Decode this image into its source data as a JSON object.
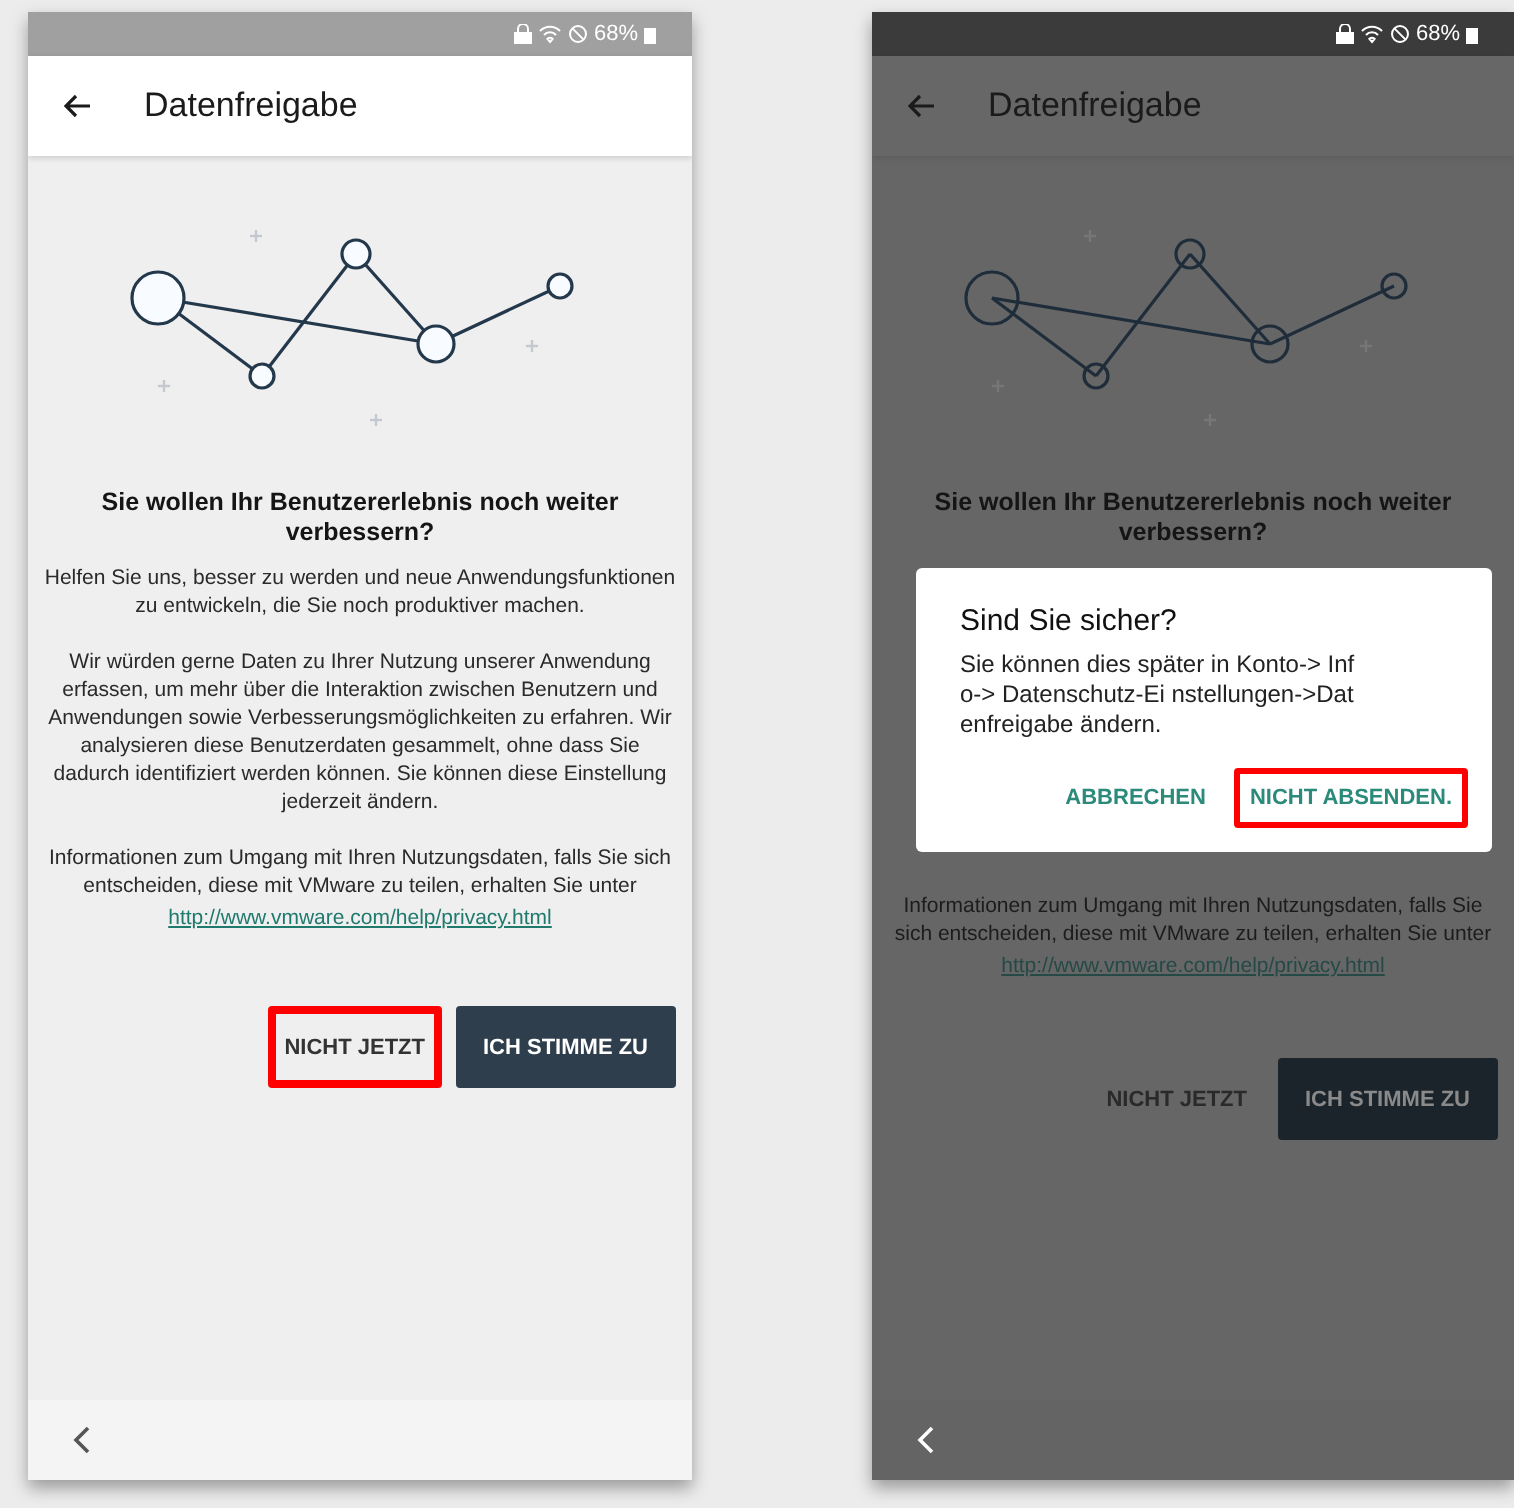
{
  "screens": [
    {
      "status_bar": {
        "battery": "68%"
      },
      "app_bar": {
        "title": "Datenfreigabe"
      },
      "dimmed": false,
      "heading": "Sie wollen Ihr Benutzererlebnis noch weiter verbessern?",
      "paragraphs": [
        "Helfen Sie uns, besser zu werden und neue Anwendungsfunktionen zu entwickeln, die Sie noch produktiver machen.",
        "Wir würden gerne Daten zu Ihrer Nutzung unserer Anwendung erfassen, um mehr über die Interaktion zwischen Benutzern und Anwendungen sowie Verbesserungsmöglichkeiten zu erfahren. Wir analysieren diese Benutzerdaten gesammelt, ohne dass Sie dadurch identifiziert werden können. Sie können diese Einstellung jederzeit ändern.",
        "Informationen zum Umgang mit Ihren Nutzungsdaten, falls Sie sich entscheiden, diese mit VMware zu teilen, erhalten Sie unter"
      ],
      "link": "http://www.vmware.com/help/privacy.html",
      "buttons": [
        {
          "label": "NICHT JETZT",
          "kind": "text",
          "highlighted": true
        },
        {
          "label": "ICH STIMME ZU",
          "kind": "filled",
          "highlighted": false
        }
      ]
    },
    {
      "status_bar": {
        "battery": "68%"
      },
      "app_bar": {
        "title": "Datenfreigabe"
      },
      "dimmed": true,
      "heading": "Sie wollen Ihr Benutzererlebnis noch weiter verbessern?",
      "paragraphs": [
        "Informationen zum Umgang mit Ihren Nutzungsdaten, falls Sie sich entscheiden, diese mit VMware zu teilen, erhalten Sie unter"
      ],
      "link": "http://www.vmware.com/help/privacy.html",
      "buttons": [
        {
          "label": "NICHT JETZT",
          "kind": "text",
          "highlighted": false
        },
        {
          "label": "ICH STIMME ZU",
          "kind": "filled",
          "highlighted": false
        }
      ],
      "dialog": {
        "title": "Sind Sie sicher?",
        "message": "Sie können dies später in Konto-> Info-> Datenschutz-Ei nstellungen->Datenfreigabe ändern.",
        "buttons": [
          {
            "label": "ABBRECHEN",
            "highlighted": false
          },
          {
            "label": "NICHT ABSENDEN.",
            "highlighted": true
          }
        ]
      }
    }
  ]
}
